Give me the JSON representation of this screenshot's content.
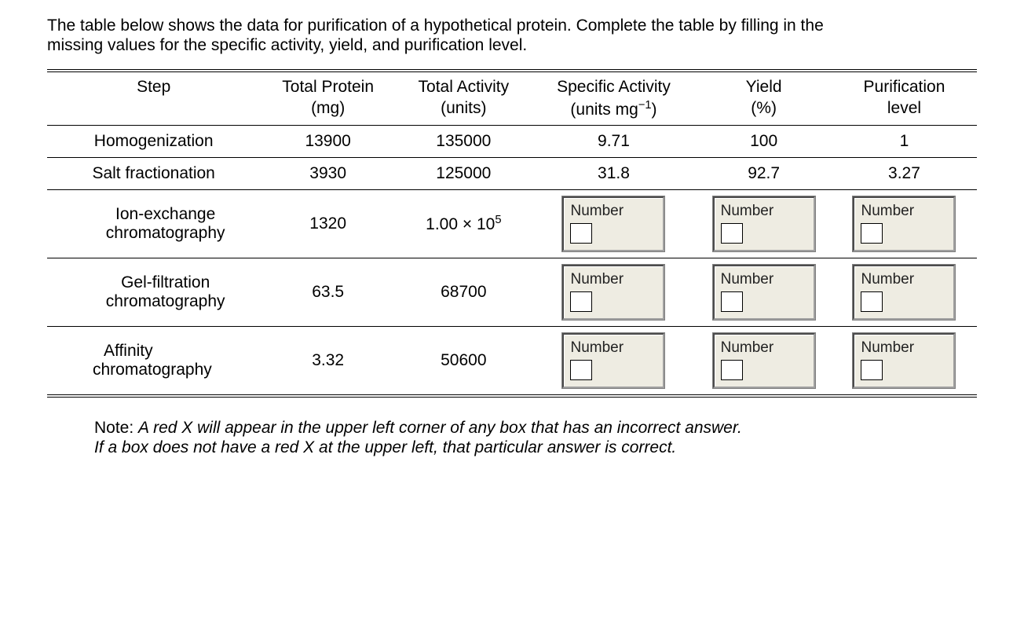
{
  "prompt": {
    "line1": "The table below shows the data for purification of a hypothetical protein. Complete the table by filling in the",
    "line2": "missing values for the specific activity, yield, and purification level."
  },
  "headers": {
    "step": "Step",
    "total_protein": "Total Protein",
    "total_protein_unit": "(mg)",
    "total_activity": "Total Activity",
    "total_activity_unit": "(units)",
    "specific_activity": "Specific Activity",
    "specific_activity_unit_pre": "(units mg",
    "specific_activity_unit_sup": "−1",
    "specific_activity_unit_post": ")",
    "yield": "Yield",
    "yield_unit": "(%)",
    "purification": "Purification",
    "purification_unit": "level"
  },
  "rows": {
    "r1": {
      "step": "Homogenization",
      "protein": "13900",
      "activity": "135000",
      "specific": "9.71",
      "yield": "100",
      "purification": "1"
    },
    "r2": {
      "step": "Salt fractionation",
      "protein": "3930",
      "activity": "125000",
      "specific": "31.8",
      "yield": "92.7",
      "purification": "3.27"
    },
    "r3": {
      "step_line1": "Ion-exchange",
      "step_line2": "chromatography",
      "protein": "1320",
      "activity_pre": "1.00 × 10",
      "activity_sup": "5",
      "input_label": "Number"
    },
    "r4": {
      "step_line1": "Gel-filtration",
      "step_line2": "chromatography",
      "protein": "63.5",
      "activity": "68700",
      "input_label": "Number"
    },
    "r5": {
      "step_line1": "Affinity",
      "step_line2": "chromatography",
      "protein": "3.32",
      "activity": "50600",
      "input_label": "Number"
    }
  },
  "note": {
    "lead": "Note: ",
    "line1": "A red X will appear in the upper left corner of any box that has an incorrect answer.",
    "line2": "If a box does not have a red X at the upper left, that particular answer is correct."
  }
}
